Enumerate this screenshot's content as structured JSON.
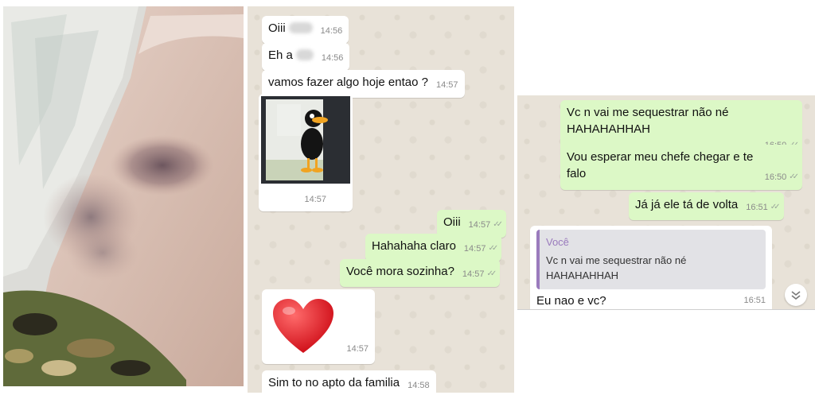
{
  "chat1": {
    "msg_oiii_in": {
      "text": "Oiii",
      "time": "14:56"
    },
    "msg_eh_a": {
      "text": "Eh a",
      "time": "14:56"
    },
    "msg_vamos": {
      "text": "vamos fazer algo hoje entao ?",
      "time": "14:57"
    },
    "sticker_duck": {
      "time": "14:57",
      "icon": "cartoon-duck-sticker"
    },
    "msg_oiii_out": {
      "text": "Oiii",
      "time": "14:57"
    },
    "msg_hahaha": {
      "text": "Hahahaha claro",
      "time": "14:57"
    },
    "msg_mora": {
      "text": "Você mora sozinha?",
      "time": "14:57"
    },
    "heart_emoji": {
      "glyph": "❤",
      "time": "14:57",
      "color": "#e0161e"
    },
    "msg_sim": {
      "text": "Sim to no apto da familia",
      "time": "14:58"
    }
  },
  "chat2": {
    "msg_sequestrar": {
      "text": "Vc n vai me sequestrar não né HAHAHAHHAH",
      "time": "16:50"
    },
    "msg_esperar": {
      "text": "Vou esperar meu chefe chegar e te falo",
      "time": "16:50"
    },
    "msg_ja": {
      "text": "Já já ele tá de volta",
      "time": "16:51"
    },
    "reply": {
      "author": "Você",
      "quoted": "Vc n vai me sequestrar não né HAHAHAHHAH",
      "text": "Eu nao e vc?",
      "time": "16:51"
    },
    "scroll_down_icon": "double-chevron-down-icon"
  },
  "colors": {
    "outgoing_bubble": "#dcf8c6",
    "incoming_bubble": "#ffffff",
    "chat_background": "#e8e2d8",
    "reply_accent": "#9a7bbd"
  }
}
